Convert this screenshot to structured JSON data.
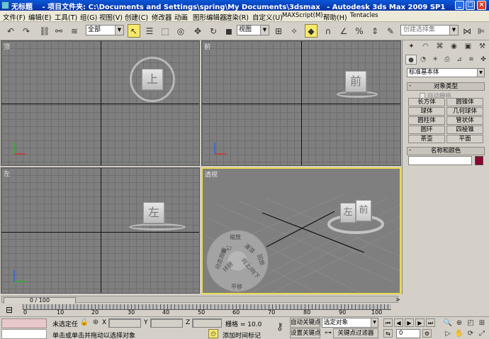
{
  "title_bar": {
    "doc_title": "无标题",
    "project_label": "- 项目文件夹: C:\\Documents and Settings\\spring\\My Documents\\3dsmax",
    "app_name": "- Autodesk 3ds Max  2009 SP1",
    "min_glyph": "_",
    "max_glyph": "□",
    "close_glyph": "×"
  },
  "menu": {
    "items": [
      "文件(F)",
      "编辑(E)",
      "工具(T)",
      "组(G)",
      "视图(V)",
      "创建(C)",
      "修改器",
      "动画",
      "图形编辑器",
      "渲染(R)",
      "自定义(U)",
      "MAXScript(M)",
      "帮助(H)",
      "Tentacles"
    ]
  },
  "toolbar": {
    "selection_filter": "全部",
    "reference_coord": "视图",
    "named_selection_placeholder": "创建选择集"
  },
  "viewports": {
    "top": {
      "label": "顶",
      "cube_text": "上"
    },
    "front": {
      "label": "前",
      "cube_text": "前"
    },
    "left": {
      "label": "左",
      "cube_text": "左"
    },
    "perspective": {
      "label": "透视",
      "cube_front": "前",
      "cube_left": "左",
      "wheel": {
        "top": "缩放",
        "orbit": "动态观察",
        "center": "中心",
        "walk": "漫游",
        "look": "环顾",
        "rewind": "回放",
        "up_down": "向上/向下",
        "pan": "平移"
      }
    }
  },
  "command_panel": {
    "category": "标准基本体",
    "object_type_title": "对象类型",
    "autogrid_label": "自动栅格",
    "buttons": [
      "长方体",
      "圆锥体",
      "球体",
      "几何球体",
      "圆柱体",
      "管状体",
      "圆环",
      "四棱锥",
      "茶壶",
      "平面"
    ],
    "name_color_title": "名称和颜色"
  },
  "timeline": {
    "frame_display": "0 / 100",
    "right_arrow": ">",
    "ruler_labels": [
      "0",
      "10",
      "20",
      "30",
      "40",
      "50",
      "60",
      "70",
      "80",
      "90",
      "100"
    ]
  },
  "status": {
    "selection": "未选定任",
    "x_label": "X",
    "y_label": "Y",
    "z_label": "Z",
    "grid": "栅格 = 10.0",
    "auto_key": "自动关键点",
    "selected_mode": "选定对象",
    "set_key": "设置关键点",
    "key_filters": "关键点过滤器",
    "prompt": "单击或单击并拖动以选择对象",
    "add_time_tag": "添加时间标记",
    "frame_value": "0"
  },
  "colors": {
    "titlebar": "#0a3fb8",
    "viewport_bg": "#7f7f7f",
    "active_border": "#e8d850",
    "object_color": "#8a0030"
  }
}
